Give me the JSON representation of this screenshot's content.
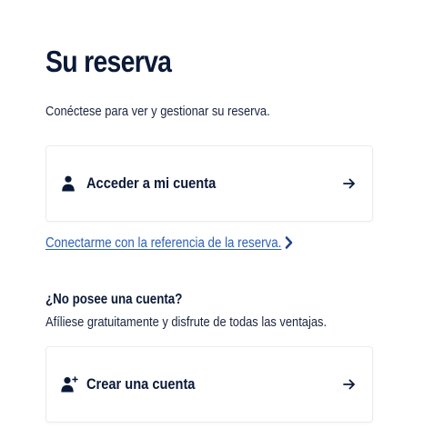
{
  "page": {
    "title": "Su reserva",
    "subtitle": "Conéctese para ver y gestionar su reserva."
  },
  "login_card": {
    "label": "Acceder a mi cuenta",
    "icon": "user-icon",
    "arrow_icon": "arrow-right-icon"
  },
  "reference_link": {
    "label": "Conectarme con la referencia de la reserva.",
    "icon": "chevron-right-icon"
  },
  "signup": {
    "heading": "¿No posee una cuenta?",
    "text": "Afíliese gratuitamente y disfrute de todas las ventajas."
  },
  "create_card": {
    "label": "Crear una cuenta",
    "icon": "add-user-icon",
    "arrow_icon": "arrow-right-icon"
  },
  "colors": {
    "text": "#0b1a38",
    "link": "#2d5fb8",
    "card_border": "#ececf0"
  }
}
